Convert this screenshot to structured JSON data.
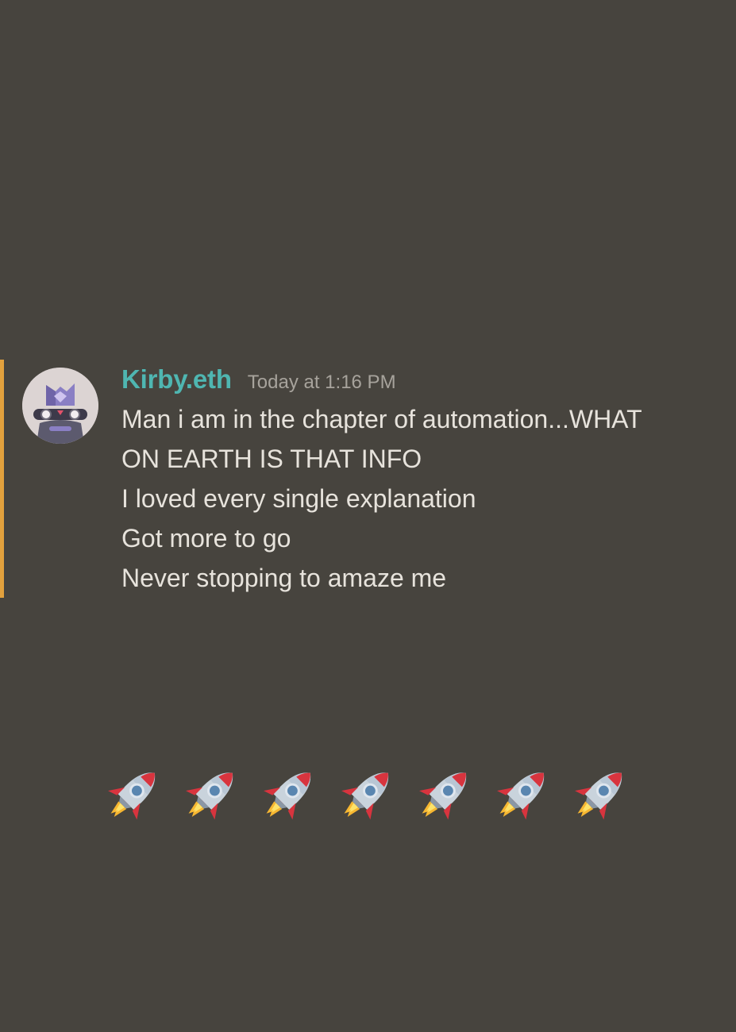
{
  "message": {
    "author": "Kirby.eth",
    "timestamp": "Today at 1:16 PM",
    "lines": [
      "Man i am in the chapter of automation...WHAT",
      "ON EARTH IS THAT INFO",
      "I loved every single explanation",
      "Got more to go",
      "Never stopping to amaze me"
    ]
  },
  "reaction_row": {
    "icon": "rocket-icon",
    "emoji": "🚀",
    "count": 7
  },
  "colors": {
    "background": "#47443e",
    "highlight": "#e2a13d",
    "username": "#4fb6b1",
    "text": "#e7e3dc",
    "timestamp": "#a7a39c"
  }
}
